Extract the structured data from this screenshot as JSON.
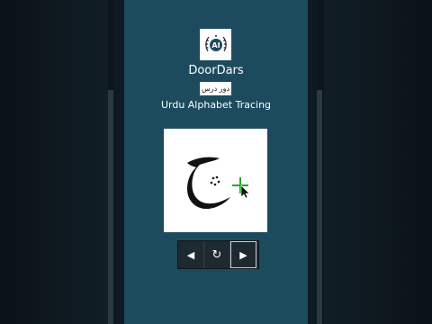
{
  "app": {
    "name": "DoorDars",
    "urdu_name": "دور درس",
    "subtitle": "Urdu Alphabet Tracing",
    "logo_text": "AI"
  },
  "tracing": {
    "letter": "ج"
  },
  "controls": {
    "prev_icon": "◀",
    "reset_icon": "↻",
    "next_icon": "▶"
  },
  "colors": {
    "screen": "#1d4b5e",
    "cursor_accent": "#22aa22"
  }
}
